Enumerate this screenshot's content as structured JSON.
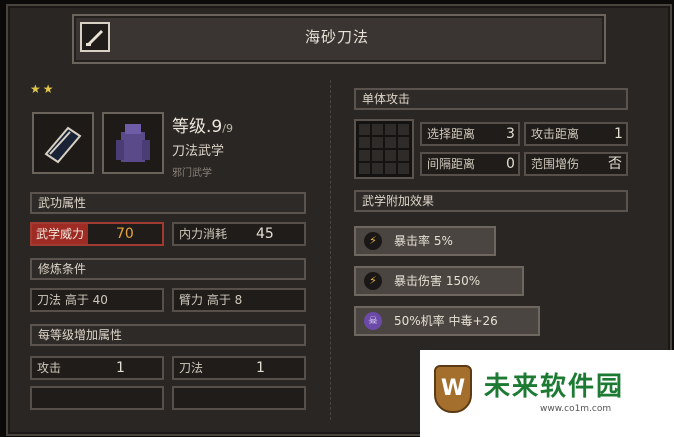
{
  "title": "海砂刀法",
  "stars": "★★",
  "level": {
    "label": "等级.9",
    "max": "/9"
  },
  "skill_type": "刀法武学",
  "sect": "邪门武学",
  "left": {
    "attr_header": "武功属性",
    "power_label": "武学威力",
    "power_value": "70",
    "mp_label": "内力消耗",
    "mp_value": "45",
    "req_header": "修炼条件",
    "req1": "刀法 高于 40",
    "req2": "臂力 高于 8",
    "perlvl_header": "每等级增加属性",
    "inc1_label": "攻击",
    "inc1_value": "1",
    "inc2_label": "刀法",
    "inc2_value": "1"
  },
  "right": {
    "attack_type": "单体攻击",
    "select_range_label": "选择距离",
    "select_range_value": "3",
    "attack_range_label": "攻击距离",
    "attack_range_value": "1",
    "interval_label": "间隔距离",
    "interval_value": "0",
    "area_label": "范围增伤",
    "area_value": "否",
    "effects_header": "武学附加效果",
    "effects": [
      {
        "icon": "lightning-icon",
        "text": "暴击率 5%"
      },
      {
        "icon": "lightning-icon",
        "text": "暴击伤害 150%"
      },
      {
        "icon": "skull-icon",
        "text": "50%机率 中毒+26"
      }
    ]
  },
  "watermark": {
    "text": "未来软件园",
    "url": "www.co1m.com",
    "logo_letter": "W"
  }
}
